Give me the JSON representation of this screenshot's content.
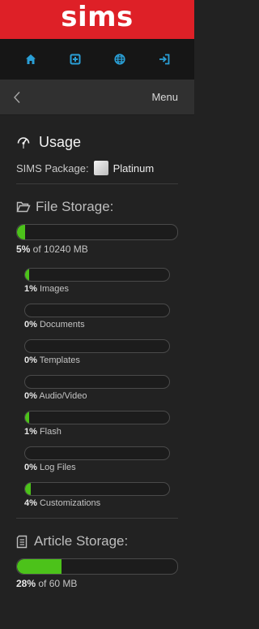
{
  "brand": {
    "logo_text": "SIMS",
    "accent_color": "#de2027"
  },
  "nav": {
    "items": [
      {
        "icon": "home-icon"
      },
      {
        "icon": "add-square-icon"
      },
      {
        "icon": "globe-icon"
      },
      {
        "icon": "sign-out-icon"
      }
    ],
    "icon_color": "#2a9fd6"
  },
  "menubar": {
    "back_icon": "chevron-left-icon",
    "label": "Menu"
  },
  "usage": {
    "title": "Usage",
    "package_label": "SIMS Package:",
    "package_value": "Platinum"
  },
  "file_storage": {
    "title": "File Storage:",
    "percent": 5,
    "percent_label": "5%",
    "total_label": " of 10240 MB",
    "categories": [
      {
        "percent": 1,
        "percent_label": "1%",
        "name": " Images"
      },
      {
        "percent": 0,
        "percent_label": "0%",
        "name": " Documents"
      },
      {
        "percent": 0,
        "percent_label": "0%",
        "name": " Templates"
      },
      {
        "percent": 0,
        "percent_label": "0%",
        "name": " Audio/Video"
      },
      {
        "percent": 1,
        "percent_label": "1%",
        "name": " Flash"
      },
      {
        "percent": 0,
        "percent_label": "0%",
        "name": " Log Files"
      },
      {
        "percent": 4,
        "percent_label": "4%",
        "name": " Customizations"
      }
    ]
  },
  "article_storage": {
    "title": "Article Storage:",
    "percent": 28,
    "percent_label": "28%",
    "total_label": " of 60 MB"
  },
  "bar_fill_color": "#4cc21a"
}
